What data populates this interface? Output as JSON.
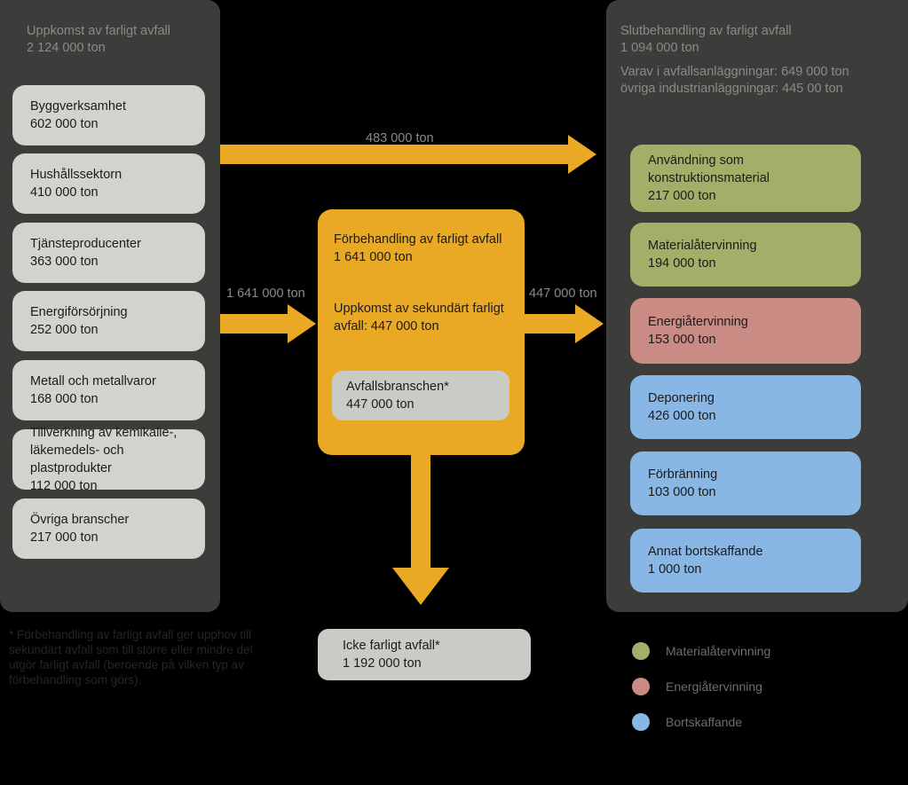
{
  "left_panel": {
    "heading": "Uppkomst av farligt avfall\n2 124 000 ton",
    "items": [
      {
        "label": "Byggverksamhet",
        "value": "602 000 ton"
      },
      {
        "label": "Hushållssektorn",
        "value": "410 000 ton"
      },
      {
        "label": "Tjänsteproducenter",
        "value": "363 000 ton"
      },
      {
        "label": "Energiförsörjning",
        "value": "252 000 ton"
      },
      {
        "label": "Metall och metallvaror",
        "value": "168 000 ton"
      },
      {
        "label": "Tillverkning av kemikalie-,\nläkemedels- och plastprodukter",
        "value": "112 000 ton"
      },
      {
        "label": "Övriga branscher",
        "value": "217 000 ton"
      }
    ]
  },
  "center": {
    "title": "Förbehandling av farligt avfall\n1 641 000 ton",
    "secondary": "Uppkomst av sekundärt farligt avfall: 447 000 ton",
    "inner_box": {
      "label": "Avfallsbranschen*",
      "value": "447 000 ton"
    },
    "bottom_box": {
      "label": "Icke farligt avfall*",
      "value": "1 192 000 ton"
    }
  },
  "right_panel": {
    "heading": "Slutbehandling av farligt avfall\n1 094 000 ton",
    "subheading": "Varav i avfallsanläggningar: 649 000 ton\növriga industrianläggningar: 445 00 ton",
    "items": [
      {
        "label": "Användning som\nkonstruktionsmaterial",
        "value": "217 000 ton",
        "color": "#a3ae69"
      },
      {
        "label": "Materialåtervinning",
        "value": "194 000 ton",
        "color": "#a3ae69"
      },
      {
        "label": "Energiåtervinning",
        "value": "153 000 ton",
        "color": "#c98b83"
      },
      {
        "label": "Deponering",
        "value": "426 000 ton",
        "color": "#88b6e5"
      },
      {
        "label": "Förbränning",
        "value": "103 000 ton",
        "color": "#88b6e5"
      },
      {
        "label": "Annat bortskaffande",
        "value": "1 000 ton",
        "color": "#88b6e5"
      }
    ]
  },
  "arrows": {
    "top": "483 000 ton",
    "into_center": "1 641 000 ton",
    "out_of_center": "447 000 ton"
  },
  "footnote": "* Förbehandling av farligt avfall ger upphov till sekundärt avfall som till större eller mindre del utgör farligt avfall (beroende på vilken typ av förbehandling som görs).",
  "legend": [
    {
      "label": "Materialåtervinning",
      "color": "#a3ae69"
    },
    {
      "label": "Energiåtervinning",
      "color": "#c98b83"
    },
    {
      "label": "Bortskaffande",
      "color": "#88b6e5"
    }
  ],
  "colors": {
    "background": "#000000",
    "panel": "#3c3c3a",
    "gray_box": "#d3d3ce",
    "yellow": "#e9a924",
    "green": "#a3ae69",
    "red": "#c98b83",
    "blue": "#88b6e5"
  }
}
